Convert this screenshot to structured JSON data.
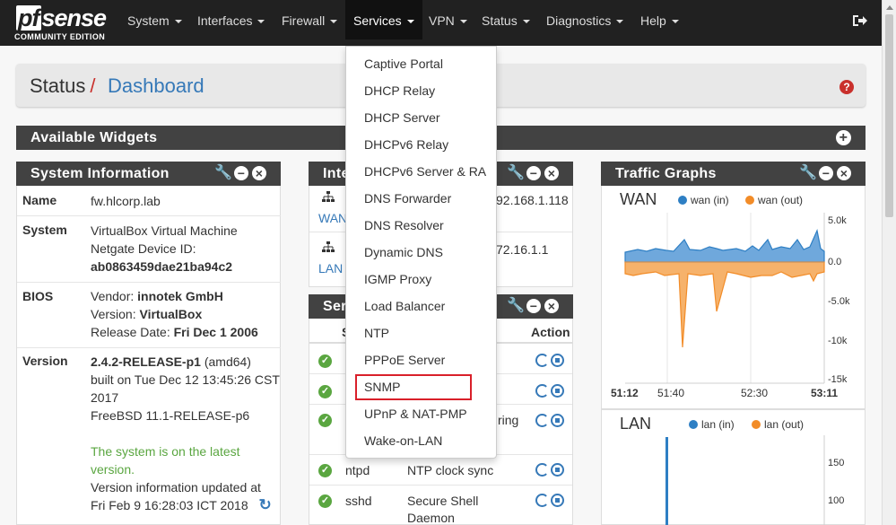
{
  "navbar": {
    "logo": {
      "brand": "pfsense",
      "edition": "COMMUNITY EDITION"
    },
    "items": [
      {
        "label": "System"
      },
      {
        "label": "Interfaces"
      },
      {
        "label": "Firewall"
      },
      {
        "label": "Services"
      },
      {
        "label": "VPN"
      },
      {
        "label": "Status"
      },
      {
        "label": "Diagnostics"
      },
      {
        "label": "Help"
      }
    ],
    "logout_icon": "sign-out-icon"
  },
  "breadcrumb": {
    "section": "Status",
    "separator": "/",
    "page": "Dashboard"
  },
  "available_widgets": {
    "title": "Available Widgets"
  },
  "system_information": {
    "title": "System Information",
    "rows": [
      {
        "label": "Name",
        "lines": [
          "fw.hlcorp.lab"
        ]
      },
      {
        "label": "System",
        "lines": [
          "VirtualBox Virtual Machine",
          "Netgate Device ID:",
          "ab0863459dae21ba94c2"
        ]
      },
      {
        "label": "BIOS",
        "vendor_prefix": "Vendor: ",
        "vendor": "innotek GmbH",
        "version_prefix": "Version: ",
        "version": "VirtualBox",
        "date_prefix": "Release Date: ",
        "date": "Fri Dec 1 2006"
      },
      {
        "label": "Version",
        "release": "2.4.2-RELEASE-p1",
        "arch": " (amd64)",
        "built1": "built on Tue Dec 12 13:45:26 CST",
        "built2": "2017",
        "freebsd": "FreeBSD 11.1-RELEASE-p6",
        "latest1": "The system is on the latest",
        "latest2": "version.",
        "updated1": "Version information updated at",
        "updated2": "Fri Feb 9 16:28:03 ICT 2018"
      }
    ]
  },
  "interfaces_widget": {
    "title_visible": "Inte",
    "rows": [
      {
        "name": "WAN",
        "ip_visible": "92.168.1.118"
      },
      {
        "name": "LAN",
        "ip_visible": "72.16.1.1"
      }
    ]
  },
  "services_widget": {
    "title_visible": "Ser",
    "col_status_visible": "S",
    "col_action": "Action",
    "rows": [
      {
        "service": "",
        "description": ""
      },
      {
        "service": "",
        "description": ""
      },
      {
        "service": "",
        "description": "ring"
      },
      {
        "service": "ntpd",
        "description": "NTP clock sync"
      },
      {
        "service": "sshd",
        "description": "Secure Shell",
        "description2": "Daemon"
      }
    ]
  },
  "services_dropdown": {
    "items": [
      "Captive Portal",
      "DHCP Relay",
      "DHCP Server",
      "DHCPv6 Relay",
      "DHCPv6 Server & RA",
      "DNS Forwarder",
      "DNS Resolver",
      "Dynamic DNS",
      "IGMP Proxy",
      "Load Balancer",
      "NTP",
      "PPPoE Server",
      "SNMP",
      "UPnP & NAT-PMP",
      "Wake-on-LAN"
    ],
    "highlighted": "SNMP"
  },
  "traffic_graphs": {
    "title": "Traffic Graphs",
    "wan": {
      "label": "WAN",
      "legend_in": "wan (in)",
      "legend_out": "wan (out)",
      "y_ticks": [
        "5.0k",
        "0.0",
        "-5.0k",
        "-10k",
        "-15k"
      ],
      "x_ticks": [
        "51:12",
        "51:40",
        "52:30",
        "53:11"
      ]
    },
    "lan": {
      "label": "LAN",
      "legend_in": "lan (in)",
      "legend_out": "lan (out)",
      "y_ticks": [
        "150",
        "100"
      ]
    },
    "colors": {
      "in": "#2e7fc4",
      "out": "#f28c28"
    }
  }
}
